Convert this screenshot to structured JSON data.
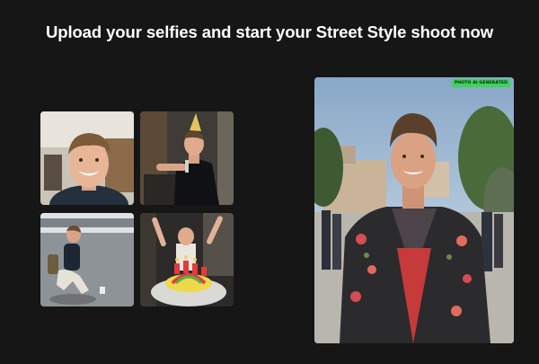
{
  "header": {
    "title": "Upload your selfies and start your Street Style shoot now"
  },
  "selfies": [
    {
      "icon": "selfie-photo-smiling-closeup"
    },
    {
      "icon": "selfie-photo-party-hat"
    },
    {
      "icon": "selfie-photo-crouching-street"
    },
    {
      "icon": "selfie-photo-birthday-cake"
    }
  ],
  "result": {
    "badge": "PHOTO AI GENERATED",
    "icon": "generated-street-style-portrait"
  },
  "colors": {
    "background": "#161616",
    "headline": "#ffffff",
    "badge": "#3ed35b"
  }
}
